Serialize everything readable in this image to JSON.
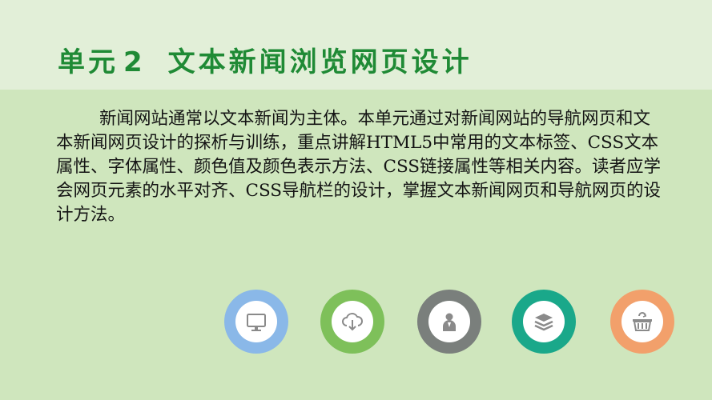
{
  "title": {
    "unit": "单元",
    "number": "2",
    "subject": "文本新闻浏览网页设计"
  },
  "body": "新闻网站通常以文本新闻为主体。本单元通过对新闻网站的导航网页和文本新闻网页设计的探析与训练，重点讲解HTML5中常用的文本标签、CSS文本属性、字体属性、颜色值及颜色表示方法、CSS链接属性等相关内容。读者应学会网页元素的水平对齐、CSS导航栏的设计，掌握文本新闻网页和导航网页的设计方法。",
  "icons": [
    {
      "name": "monitor-icon",
      "color": "#8ab8e8"
    },
    {
      "name": "cloud-download-icon",
      "color": "#7ec05a"
    },
    {
      "name": "user-icon",
      "color": "#7a7f7c"
    },
    {
      "name": "stack-icon",
      "color": "#1aa88a"
    },
    {
      "name": "basket-icon",
      "color": "#f2a06b"
    }
  ]
}
